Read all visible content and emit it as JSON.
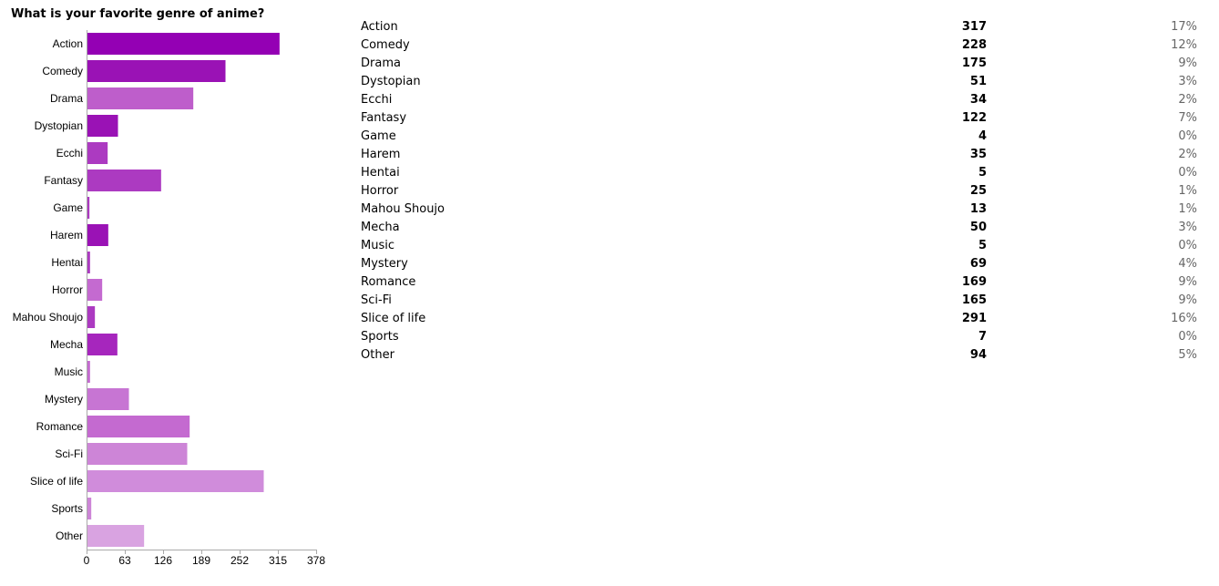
{
  "chart_data": {
    "type": "bar",
    "orientation": "horizontal",
    "title": "What is your favorite genre of anime?",
    "categories": [
      "Action",
      "Comedy",
      "Drama",
      "Dystopian",
      "Ecchi",
      "Fantasy",
      "Game",
      "Harem",
      "Hentai",
      "Horror",
      "Mahou Shoujo",
      "Mecha",
      "Music",
      "Mystery",
      "Romance",
      "Sci-Fi",
      "Slice of life",
      "Sports",
      "Other"
    ],
    "values": [
      317,
      228,
      175,
      51,
      34,
      122,
      4,
      35,
      5,
      25,
      13,
      50,
      5,
      69,
      169,
      165,
      291,
      7,
      94
    ],
    "percentages": [
      "17%",
      "12%",
      "9%",
      "3%",
      "2%",
      "7%",
      "0%",
      "2%",
      "0%",
      "1%",
      "1%",
      "3%",
      "0%",
      "4%",
      "9%",
      "9%",
      "16%",
      "0%",
      "5%"
    ],
    "colors": [
      "#9400b4",
      "#9a12b5",
      "#be5ecb",
      "#9a12b5",
      "#ac3ac1",
      "#ac3ac1",
      "#ac3ac1",
      "#9a12b5",
      "#ac3ac1",
      "#c46ad0",
      "#ac3ac1",
      "#a626bd",
      "#c46ad0",
      "#c775d3",
      "#c46ad0",
      "#cd85d7",
      "#d08cdb",
      "#cd85d7",
      "#d9a3e1"
    ],
    "xticks": [
      "0",
      "63",
      "126",
      "189",
      "252",
      "315",
      "378"
    ],
    "xlim": [
      0,
      378
    ],
    "xlabel": "",
    "ylabel": "",
    "grid": false,
    "legend": false
  }
}
